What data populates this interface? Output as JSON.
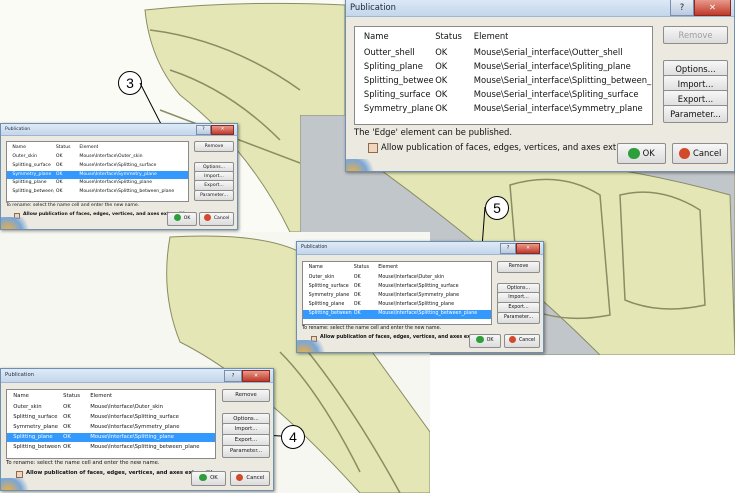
{
  "colors": {
    "model_fill": "#e4e7b5",
    "model_edge": "#8a8c63",
    "model_bg": "#c1c6ca",
    "selection": "#3399ff"
  },
  "callouts": [
    "3",
    "4",
    "5"
  ],
  "dialog_main": {
    "title": "Publication",
    "columns": [
      "Name",
      "Status",
      "Element"
    ],
    "rows": [
      {
        "name": "Outter_shell",
        "status": "OK",
        "element": "Mouse\\Serial_interface\\Outter_shell"
      },
      {
        "name": "Spliting_plane",
        "status": "OK",
        "element": "Mouse\\Serial_interface\\Spliting_plane"
      },
      {
        "name": "Splitting_betwee...",
        "status": "OK",
        "element": "Mouse\\Serial_interface\\Splitting_between_plane"
      },
      {
        "name": "Spliting_surface",
        "status": "OK",
        "element": "Mouse\\Serial_interface\\Spliting_surface"
      },
      {
        "name": "Symmetry_plane",
        "status": "OK",
        "element": "Mouse\\Serial_interface\\Symmetry_plane"
      }
    ],
    "buttons": {
      "remove": "Remove",
      "options": "Options...",
      "import": "Import...",
      "export": "Export...",
      "parameter": "Parameter..."
    },
    "message": "The 'Edge' element can be published.",
    "checkbox_label": "Allow publication of faces, edges, vertices, and axes extremities",
    "ok": "OK",
    "cancel": "Cancel"
  },
  "dialog_small": {
    "title": "Publication",
    "columns": [
      "Name",
      "Status",
      "Element"
    ],
    "rows": [
      {
        "name": "Outer_skin",
        "status": "OK",
        "element": "Mouse\\Interface\\Outer_skin"
      },
      {
        "name": "Splitting_surface",
        "status": "OK",
        "element": "Mouse\\Interface\\Splitting_surface"
      },
      {
        "name": "Symmetry_plane",
        "status": "OK",
        "element": "Mouse\\Interface\\Symmetry_plane"
      },
      {
        "name": "Splitting_plane",
        "status": "OK",
        "element": "Mouse\\Interface\\Splitting_plane"
      },
      {
        "name": "Splitting_between_plane",
        "status": "OK",
        "element": "Mouse\\Interface\\Splitting_between_plane"
      }
    ],
    "buttons": {
      "remove": "Remove",
      "options": "Options...",
      "import": "Import...",
      "export": "Export...",
      "parameter": "Parameter..."
    },
    "message": "To rename: select the name cell and enter the new name.",
    "checkbox_label": "Allow publication of faces, edges, vertices, and axes extremities",
    "ok": "OK",
    "cancel": "Cancel"
  }
}
